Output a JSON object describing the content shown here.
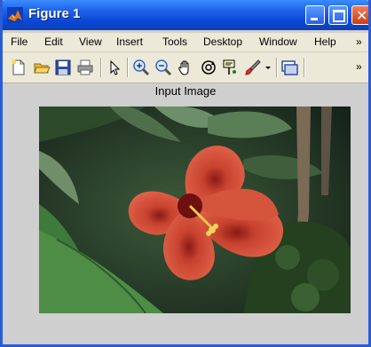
{
  "window": {
    "title": "Figure 1",
    "controls": {
      "minimize": "minimize",
      "maximize": "maximize",
      "close": "close"
    }
  },
  "menubar": {
    "items": [
      "File",
      "Edit",
      "View",
      "Insert",
      "Tools",
      "Desktop",
      "Window",
      "Help"
    ],
    "overflow": "»"
  },
  "toolbar": {
    "buttons": [
      "new-figure-icon",
      "open-file-icon",
      "save-icon",
      "print-icon",
      "select-arrow-icon",
      "zoom-in-icon",
      "zoom-out-icon",
      "pan-hand-icon",
      "rotate-3d-icon",
      "data-cursor-icon",
      "brush-icon",
      "dropdown-arrow-icon",
      "link-plot-icon"
    ],
    "overflow": "»"
  },
  "figure": {
    "axes_title": "Input Image",
    "image_subject": "red hibiscus flower"
  },
  "colors": {
    "titlebar": "#0a48d6",
    "menubar": "#ece9d8",
    "figure_bg": "#cfcfcf",
    "flower": "#d9533f"
  }
}
